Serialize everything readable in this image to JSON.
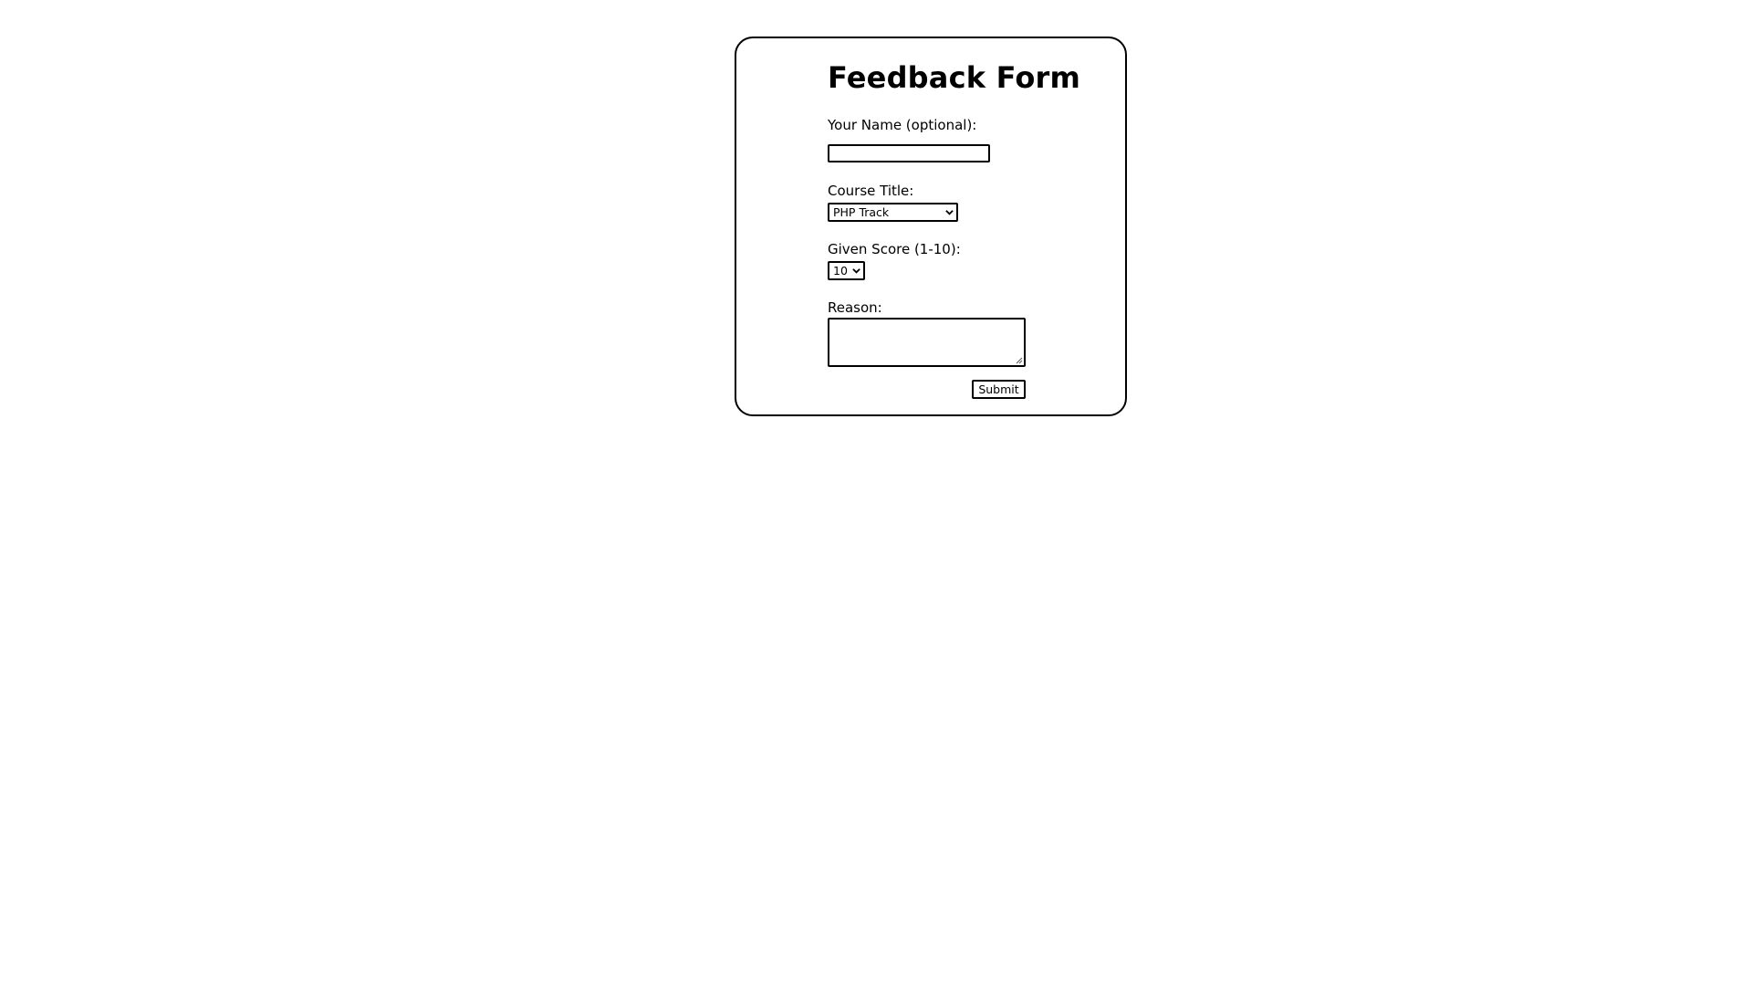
{
  "form": {
    "title": "Feedback Form",
    "name_label": "Your Name (optional):",
    "name_value": "",
    "course_label": "Course Title:",
    "course_selected": "PHP Track",
    "score_label": "Given Score (1-10):",
    "score_selected": "10",
    "reason_label": "Reason:",
    "reason_value": "",
    "submit_label": "Submit"
  },
  "icons": {
    "course_dropdown": "chevron-down-icon",
    "score_dropdown": "chevron-down-icon",
    "textarea_resize": "resize-grip-icon"
  }
}
